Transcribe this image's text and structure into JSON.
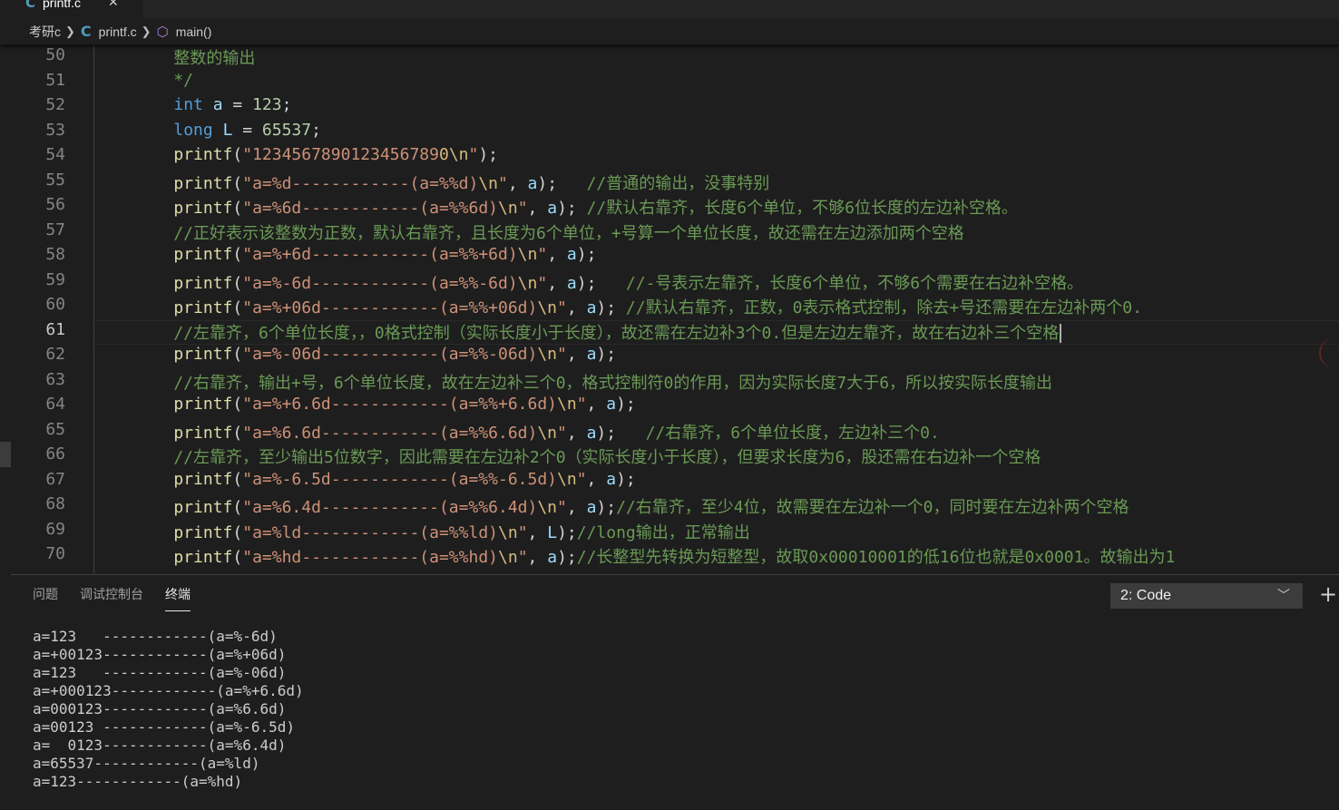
{
  "tab": {
    "filename": "printf.c",
    "close": "✕"
  },
  "breadcrumb": {
    "folder": "考研c",
    "file": "printf.c",
    "symbol": "main()"
  },
  "editor": {
    "lines": [
      {
        "n": "50",
        "code": [
          [
            "cmt",
            "    整数的输出"
          ]
        ]
      },
      {
        "n": "51",
        "code": [
          [
            "cmt",
            "    */"
          ]
        ]
      },
      {
        "n": "52",
        "code": [
          [
            "pun",
            "    "
          ],
          [
            "kw",
            "int"
          ],
          [
            "pun",
            " "
          ],
          [
            "var",
            "a"
          ],
          [
            "pun",
            " = "
          ],
          [
            "num",
            "123"
          ],
          [
            "pun",
            ";"
          ]
        ]
      },
      {
        "n": "53",
        "code": [
          [
            "pun",
            "    "
          ],
          [
            "kw",
            "long"
          ],
          [
            "pun",
            " "
          ],
          [
            "var",
            "L"
          ],
          [
            "pun",
            " = "
          ],
          [
            "num",
            "65537"
          ],
          [
            "pun",
            ";"
          ]
        ]
      },
      {
        "n": "54",
        "code": [
          [
            "pun",
            "    "
          ],
          [
            "fn",
            "printf"
          ],
          [
            "pun",
            "("
          ],
          [
            "str",
            "\"1234567890123456789"
          ],
          [
            "esc",
            "0\\n"
          ],
          [
            "str",
            "\""
          ],
          [
            "pun",
            ");"
          ]
        ]
      },
      {
        "n": "55",
        "code": [
          [
            "pun",
            "    "
          ],
          [
            "fn",
            "printf"
          ],
          [
            "pun",
            "("
          ],
          [
            "str",
            "\"a=%d------------(a=%%d)"
          ],
          [
            "esc",
            "\\n"
          ],
          [
            "str",
            "\""
          ],
          [
            "pun",
            ", "
          ],
          [
            "var",
            "a"
          ],
          [
            "pun",
            ");   "
          ],
          [
            "cmt",
            "//普通的输出，没事特别"
          ]
        ]
      },
      {
        "n": "56",
        "code": [
          [
            "pun",
            "    "
          ],
          [
            "fn",
            "printf"
          ],
          [
            "pun",
            "("
          ],
          [
            "str",
            "\"a=%6d------------(a=%%6d)"
          ],
          [
            "esc",
            "\\n"
          ],
          [
            "str",
            "\""
          ],
          [
            "pun",
            ", "
          ],
          [
            "var",
            "a"
          ],
          [
            "pun",
            "); "
          ],
          [
            "cmt",
            "//默认右靠齐，长度6个单位，不够6位长度的左边补空格。"
          ]
        ]
      },
      {
        "n": "57",
        "code": [
          [
            "cmt",
            "    //正好表示该整数为正数，默认右靠齐，且长度为6个单位，+号算一个单位长度，故还需在左边添加两个空格"
          ]
        ]
      },
      {
        "n": "58",
        "code": [
          [
            "pun",
            "    "
          ],
          [
            "fn",
            "printf"
          ],
          [
            "pun",
            "("
          ],
          [
            "str",
            "\"a=%+6d------------(a=%%+6d)"
          ],
          [
            "esc",
            "\\n"
          ],
          [
            "str",
            "\""
          ],
          [
            "pun",
            ", "
          ],
          [
            "var",
            "a"
          ],
          [
            "pun",
            ");"
          ]
        ]
      },
      {
        "n": "59",
        "code": [
          [
            "pun",
            "    "
          ],
          [
            "fn",
            "printf"
          ],
          [
            "pun",
            "("
          ],
          [
            "str",
            "\"a=%-6d------------(a=%%-6d)"
          ],
          [
            "esc",
            "\\n"
          ],
          [
            "str",
            "\""
          ],
          [
            "pun",
            ", "
          ],
          [
            "var",
            "a"
          ],
          [
            "pun",
            ");   "
          ],
          [
            "cmt",
            "//-号表示左靠齐，长度6个单位，不够6个需要在右边补空格。"
          ]
        ]
      },
      {
        "n": "60",
        "code": [
          [
            "pun",
            "    "
          ],
          [
            "fn",
            "printf"
          ],
          [
            "pun",
            "("
          ],
          [
            "str",
            "\"a=%+06d------------(a=%%+06d)"
          ],
          [
            "esc",
            "\\n"
          ],
          [
            "str",
            "\""
          ],
          [
            "pun",
            ", "
          ],
          [
            "var",
            "a"
          ],
          [
            "pun",
            "); "
          ],
          [
            "cmt",
            "//默认右靠齐，正数，0表示格式控制，除去+号还需要在左边补两个0."
          ]
        ]
      },
      {
        "n": "61",
        "current": true,
        "code": [
          [
            "cmt",
            "    //左靠齐，6个单位长度，，0格式控制（实际长度小于长度），故还需在左边补3个0.但是左边左靠齐，故在右边补三个空格"
          ]
        ]
      },
      {
        "n": "62",
        "code": [
          [
            "pun",
            "    "
          ],
          [
            "fn",
            "printf"
          ],
          [
            "pun",
            "("
          ],
          [
            "str",
            "\"a=%-06d------------(a=%%-06d)"
          ],
          [
            "esc",
            "\\n"
          ],
          [
            "str",
            "\""
          ],
          [
            "pun",
            ", "
          ],
          [
            "var",
            "a"
          ],
          [
            "pun",
            ");"
          ]
        ]
      },
      {
        "n": "63",
        "code": [
          [
            "cmt",
            "    //右靠齐，输出+号，6个单位长度，故在左边补三个0，格式控制符0的作用，因为实际长度7大于6，所以按实际长度输出"
          ]
        ]
      },
      {
        "n": "64",
        "code": [
          [
            "pun",
            "    "
          ],
          [
            "fn",
            "printf"
          ],
          [
            "pun",
            "("
          ],
          [
            "str",
            "\"a=%+6.6d------------(a=%%+6.6d)"
          ],
          [
            "esc",
            "\\n"
          ],
          [
            "str",
            "\""
          ],
          [
            "pun",
            ", "
          ],
          [
            "var",
            "a"
          ],
          [
            "pun",
            ");"
          ]
        ]
      },
      {
        "n": "65",
        "code": [
          [
            "pun",
            "    "
          ],
          [
            "fn",
            "printf"
          ],
          [
            "pun",
            "("
          ],
          [
            "str",
            "\"a=%6.6d------------(a=%%6.6d)"
          ],
          [
            "esc",
            "\\n"
          ],
          [
            "str",
            "\""
          ],
          [
            "pun",
            ", "
          ],
          [
            "var",
            "a"
          ],
          [
            "pun",
            ");   "
          ],
          [
            "cmt",
            "//右靠齐，6个单位长度，左边补三个0."
          ]
        ]
      },
      {
        "n": "66",
        "code": [
          [
            "cmt",
            "    //左靠齐，至少输出5位数字，因此需要在左边补2个0（实际长度小于长度），但要求长度为6，股还需在右边补一个空格"
          ]
        ]
      },
      {
        "n": "67",
        "code": [
          [
            "pun",
            "    "
          ],
          [
            "fn",
            "printf"
          ],
          [
            "pun",
            "("
          ],
          [
            "str",
            "\"a=%-6.5d------------(a=%%-6.5d)"
          ],
          [
            "esc",
            "\\n"
          ],
          [
            "str",
            "\""
          ],
          [
            "pun",
            ", "
          ],
          [
            "var",
            "a"
          ],
          [
            "pun",
            ");"
          ]
        ]
      },
      {
        "n": "68",
        "code": [
          [
            "pun",
            "    "
          ],
          [
            "fn",
            "printf"
          ],
          [
            "pun",
            "("
          ],
          [
            "str",
            "\"a=%6.4d------------(a=%%6.4d)"
          ],
          [
            "esc",
            "\\n"
          ],
          [
            "str",
            "\""
          ],
          [
            "pun",
            ", "
          ],
          [
            "var",
            "a"
          ],
          [
            "pun",
            ");"
          ],
          [
            "cmt",
            "//右靠齐，至少4位，故需要在左边补一个0，同时要在左边补两个空格"
          ]
        ]
      },
      {
        "n": "69",
        "code": [
          [
            "pun",
            "    "
          ],
          [
            "fn",
            "printf"
          ],
          [
            "pun",
            "("
          ],
          [
            "str",
            "\"a=%ld------------(a=%%ld)"
          ],
          [
            "esc",
            "\\n"
          ],
          [
            "str",
            "\""
          ],
          [
            "pun",
            ", "
          ],
          [
            "var",
            "L"
          ],
          [
            "pun",
            ");"
          ],
          [
            "cmt",
            "//long输出，正常输出"
          ]
        ]
      },
      {
        "n": "70",
        "code": [
          [
            "pun",
            "    "
          ],
          [
            "fn",
            "printf"
          ],
          [
            "pun",
            "("
          ],
          [
            "str",
            "\"a=%hd------------(a=%%hd)"
          ],
          [
            "esc",
            "\\n"
          ],
          [
            "str",
            "\""
          ],
          [
            "pun",
            ", "
          ],
          [
            "var",
            "a"
          ],
          [
            "pun",
            ");"
          ],
          [
            "cmt",
            "//长整型先转换为短整型，故取0x00010001的低16位也就是0x0001。故输出为1"
          ]
        ]
      }
    ]
  },
  "panel": {
    "tabs": [
      "问题",
      "调试控制台",
      "终端"
    ],
    "active_tab": 2,
    "terminal_select": "2: Code",
    "add_button": "+"
  },
  "terminal": {
    "lines": [
      "a=123   ------------(a=%-6d)",
      "a=+00123------------(a=%+06d)",
      "a=123   ------------(a=%-06d)",
      "a=+000123------------(a=%+6.6d)",
      "a=000123------------(a=%6.6d)",
      "a=00123 ------------(a=%-6.5d)",
      "a=  0123------------(a=%6.4d)",
      "a=65537------------(a=%ld)",
      "a=123------------(a=%hd)"
    ]
  },
  "colors": {
    "background": "#1e1e1e",
    "keyword": "#569cd6",
    "function": "#dcdcaa",
    "string": "#ce9178",
    "number": "#b5cea8",
    "variable": "#9cdcfe",
    "comment": "#6a9955",
    "file_icon": "#519aba"
  },
  "icons": {
    "file": "c-language-icon",
    "symbol": "cube-icon",
    "separator": "chevron-right-icon",
    "dropdown": "chevron-down-icon"
  }
}
